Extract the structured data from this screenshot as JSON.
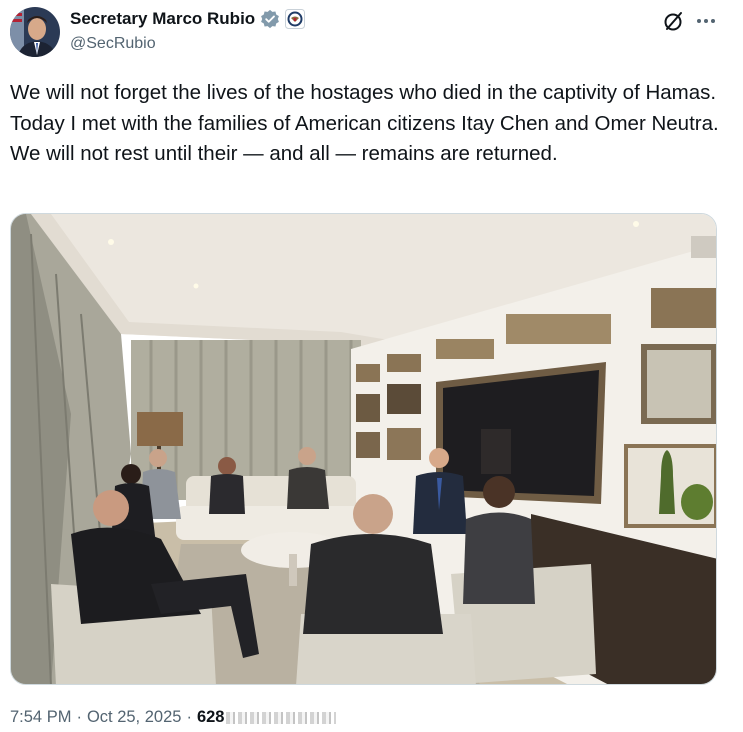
{
  "author": {
    "display_name": "Secretary Marco Rubio",
    "handle": "@SecRubio",
    "verified_color": "#829aab"
  },
  "tweet": {
    "text": "We will not forget the lives of the hostages who died in the captivity of Hamas. Today I met with the families of American citizens Itay Chen and Omer Neutra. We will not rest until their — and all — remains are returned."
  },
  "meta": {
    "time": "7:54 PM",
    "date": "Oct 25, 2025",
    "separator": "·",
    "views": "628"
  },
  "icons": {
    "grok": "grok-icon",
    "more": "more-icon",
    "verified": "verified-badge-icon",
    "seal": "state-department-seal-icon"
  },
  "colors": {
    "text_primary": "#0f1419",
    "text_secondary": "#536471",
    "border": "#cfd9de"
  }
}
